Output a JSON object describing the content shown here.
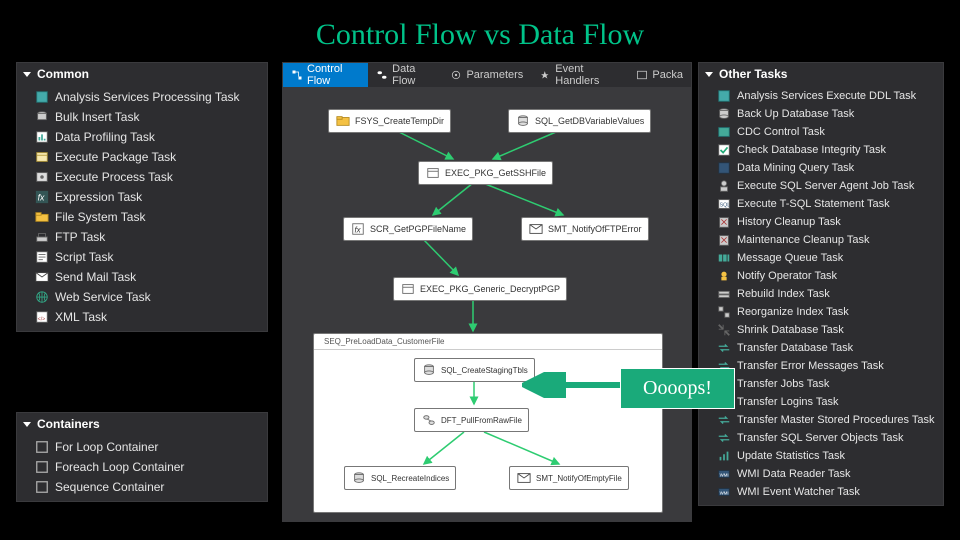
{
  "title": "Control Flow vs Data Flow",
  "left_common": {
    "header": "Common",
    "items": [
      {
        "label": "Analysis Services Processing Task",
        "icon": "cube"
      },
      {
        "label": "Bulk Insert Task",
        "icon": "db-insert"
      },
      {
        "label": "Data Profiling Task",
        "icon": "profile"
      },
      {
        "label": "Execute Package Task",
        "icon": "package"
      },
      {
        "label": "Execute Process Task",
        "icon": "process"
      },
      {
        "label": "Expression Task",
        "icon": "fx"
      },
      {
        "label": "File System Task",
        "icon": "folder"
      },
      {
        "label": "FTP Task",
        "icon": "ftp"
      },
      {
        "label": "Script Task",
        "icon": "script"
      },
      {
        "label": "Send Mail Task",
        "icon": "mail"
      },
      {
        "label": "Web Service Task",
        "icon": "globe"
      },
      {
        "label": "XML Task",
        "icon": "xml"
      }
    ]
  },
  "left_containers": {
    "header": "Containers",
    "items": [
      {
        "label": "For Loop Container",
        "icon": "container"
      },
      {
        "label": "Foreach Loop Container",
        "icon": "container"
      },
      {
        "label": "Sequence Container",
        "icon": "container"
      }
    ]
  },
  "right_other": {
    "header": "Other Tasks",
    "items": [
      {
        "label": "Analysis Services Execute DDL Task",
        "icon": "cube"
      },
      {
        "label": "Back Up Database Task",
        "icon": "db"
      },
      {
        "label": "CDC Control Task",
        "icon": "cdc"
      },
      {
        "label": "Check Database Integrity Task",
        "icon": "check"
      },
      {
        "label": "Data Mining Query Task",
        "icon": "mining"
      },
      {
        "label": "Execute SQL Server Agent Job Task",
        "icon": "agent"
      },
      {
        "label": "Execute T-SQL Statement Task",
        "icon": "sql"
      },
      {
        "label": "History Cleanup Task",
        "icon": "cleanup"
      },
      {
        "label": "Maintenance Cleanup Task",
        "icon": "cleanup"
      },
      {
        "label": "Message Queue Task",
        "icon": "queue"
      },
      {
        "label": "Notify Operator Task",
        "icon": "notify"
      },
      {
        "label": "Rebuild Index Task",
        "icon": "rebuild"
      },
      {
        "label": "Reorganize Index Task",
        "icon": "reorg"
      },
      {
        "label": "Shrink Database Task",
        "icon": "shrink"
      },
      {
        "label": "Transfer Database Task",
        "icon": "transfer"
      },
      {
        "label": "Transfer Error Messages Task",
        "icon": "transfer"
      },
      {
        "label": "Transfer Jobs Task",
        "icon": "transfer"
      },
      {
        "label": "Transfer Logins Task",
        "icon": "transfer"
      },
      {
        "label": "Transfer Master Stored Procedures Task",
        "icon": "transfer"
      },
      {
        "label": "Transfer SQL Server Objects Task",
        "icon": "transfer"
      },
      {
        "label": "Update Statistics Task",
        "icon": "stats"
      },
      {
        "label": "WMI Data Reader Task",
        "icon": "wmi"
      },
      {
        "label": "WMI Event Watcher Task",
        "icon": "wmi"
      }
    ]
  },
  "designer": {
    "tabs": [
      {
        "label": "Control Flow",
        "icon": "flow",
        "active": true
      },
      {
        "label": "Data Flow",
        "icon": "dataflow",
        "active": false
      },
      {
        "label": "Parameters",
        "icon": "params",
        "active": false
      },
      {
        "label": "Event Handlers",
        "icon": "event",
        "active": false
      },
      {
        "label": "Packa",
        "icon": "pkg",
        "active": false
      }
    ],
    "nodes": {
      "n1": "FSYS_CreateTempDir",
      "n2": "SQL_GetDBVariableValues",
      "n3": "EXEC_PKG_GetSSHFile",
      "n4": "SCR_GetPGPFileName",
      "n5": "SMT_NotifyOfFTPError",
      "n6": "EXEC_PKG_Generic_DecryptPGP",
      "seq": "SEQ_PreLoadData_CustomerFile",
      "s1": "SQL_CreateStagingTbls",
      "s2": "DFT_PullFromRawFile",
      "s3": "SQL_RecreateIndices",
      "s4": "SMT_NotifyOfEmptyFile"
    }
  },
  "callout": "Oooops!"
}
